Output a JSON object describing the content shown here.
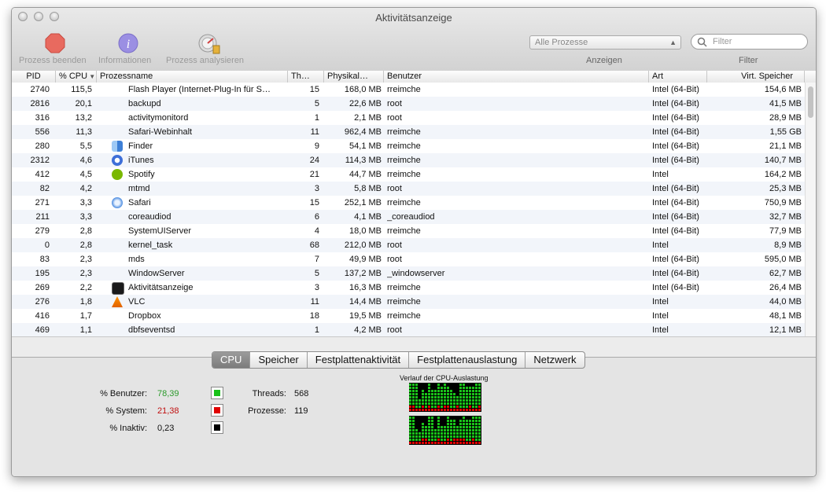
{
  "window": {
    "title": "Aktivitätsanzeige"
  },
  "toolbar": {
    "quit_label": "Prozess beenden",
    "info_label": "Informationen",
    "analyze_label": "Prozess analysieren",
    "show_select": "Alle Prozesse",
    "show_label": "Anzeigen",
    "filter_placeholder": "Filter",
    "filter_label": "Filter"
  },
  "table": {
    "columns": [
      "PID",
      "% CPU",
      "Prozessname",
      "Th…",
      "Physikal…",
      "Benutzer",
      "Art",
      "Virt. Speicher"
    ],
    "rows": [
      [
        "2740",
        "115,5",
        "Flash Player (Internet-Plug-In für S…",
        "15",
        "168,0 MB",
        "rreimche",
        "Intel (64-Bit)",
        "154,6 MB"
      ],
      [
        "2816",
        "20,1",
        "backupd",
        "5",
        "22,6 MB",
        "root",
        "Intel (64-Bit)",
        "41,5 MB"
      ],
      [
        "316",
        "13,2",
        "activitymonitord",
        "1",
        "2,1 MB",
        "root",
        "Intel (64-Bit)",
        "28,9 MB"
      ],
      [
        "556",
        "11,3",
        "Safari-Webinhalt",
        "11",
        "962,4 MB",
        "rreimche",
        "Intel (64-Bit)",
        "1,55 GB"
      ],
      [
        "280",
        "5,5",
        "Finder",
        "9",
        "54,1 MB",
        "rreimche",
        "Intel (64-Bit)",
        "21,1 MB"
      ],
      [
        "2312",
        "4,6",
        "iTunes",
        "24",
        "114,3 MB",
        "rreimche",
        "Intel (64-Bit)",
        "140,7 MB"
      ],
      [
        "412",
        "4,5",
        "Spotify",
        "21",
        "44,7 MB",
        "rreimche",
        "Intel",
        "164,2 MB"
      ],
      [
        "82",
        "4,2",
        "mtmd",
        "3",
        "5,8 MB",
        "root",
        "Intel (64-Bit)",
        "25,3 MB"
      ],
      [
        "271",
        "3,3",
        "Safari",
        "15",
        "252,1 MB",
        "rreimche",
        "Intel (64-Bit)",
        "750,9 MB"
      ],
      [
        "211",
        "3,3",
        "coreaudiod",
        "6",
        "4,1 MB",
        "_coreaudiod",
        "Intel (64-Bit)",
        "32,7 MB"
      ],
      [
        "279",
        "2,8",
        "SystemUIServer",
        "4",
        "18,0 MB",
        "rreimche",
        "Intel (64-Bit)",
        "77,9 MB"
      ],
      [
        "0",
        "2,8",
        "kernel_task",
        "68",
        "212,0 MB",
        "root",
        "Intel",
        "8,9 MB"
      ],
      [
        "83",
        "2,3",
        "mds",
        "7",
        "49,9 MB",
        "root",
        "Intel (64-Bit)",
        "595,0 MB"
      ],
      [
        "195",
        "2,3",
        "WindowServer",
        "5",
        "137,2 MB",
        "_windowserver",
        "Intel (64-Bit)",
        "62,7 MB"
      ],
      [
        "269",
        "2,2",
        "Aktivitätsanzeige",
        "3",
        "16,3 MB",
        "rreimche",
        "Intel (64-Bit)",
        "26,4 MB"
      ],
      [
        "276",
        "1,8",
        "VLC",
        "11",
        "14,4 MB",
        "rreimche",
        "Intel",
        "44,0 MB"
      ],
      [
        "416",
        "1,7",
        "Dropbox",
        "18",
        "19,5 MB",
        "rreimche",
        "Intel",
        "48,1 MB"
      ],
      [
        "469",
        "1,1",
        "dbfseventsd",
        "1",
        "4,2 MB",
        "root",
        "Intel",
        "12,1 MB"
      ]
    ],
    "row_icons": [
      "",
      "",
      "",
      "",
      "finder-icon",
      "itunes-icon",
      "spotify-icon",
      "",
      "safari-icon",
      "",
      "",
      "",
      "",
      "",
      "activity-monitor-icon",
      "vlc-icon",
      "",
      ""
    ]
  },
  "tabs": [
    "CPU",
    "Speicher",
    "Festplattenaktivität",
    "Festplattenauslastung",
    "Netzwerk"
  ],
  "active_tab": "CPU",
  "cpu": {
    "user_label": "% Benutzer:",
    "user_value": "78,39",
    "system_label": "% System:",
    "system_value": "21,38",
    "idle_label": "% Inaktiv:",
    "idle_value": "0,23",
    "threads_label": "Threads:",
    "threads_value": "568",
    "processes_label": "Prozesse:",
    "processes_value": "119",
    "history_title": "Verlauf der CPU-Auslastung",
    "colors": {
      "user": "#19c219",
      "system": "#e00000",
      "idle": "#000000"
    }
  }
}
